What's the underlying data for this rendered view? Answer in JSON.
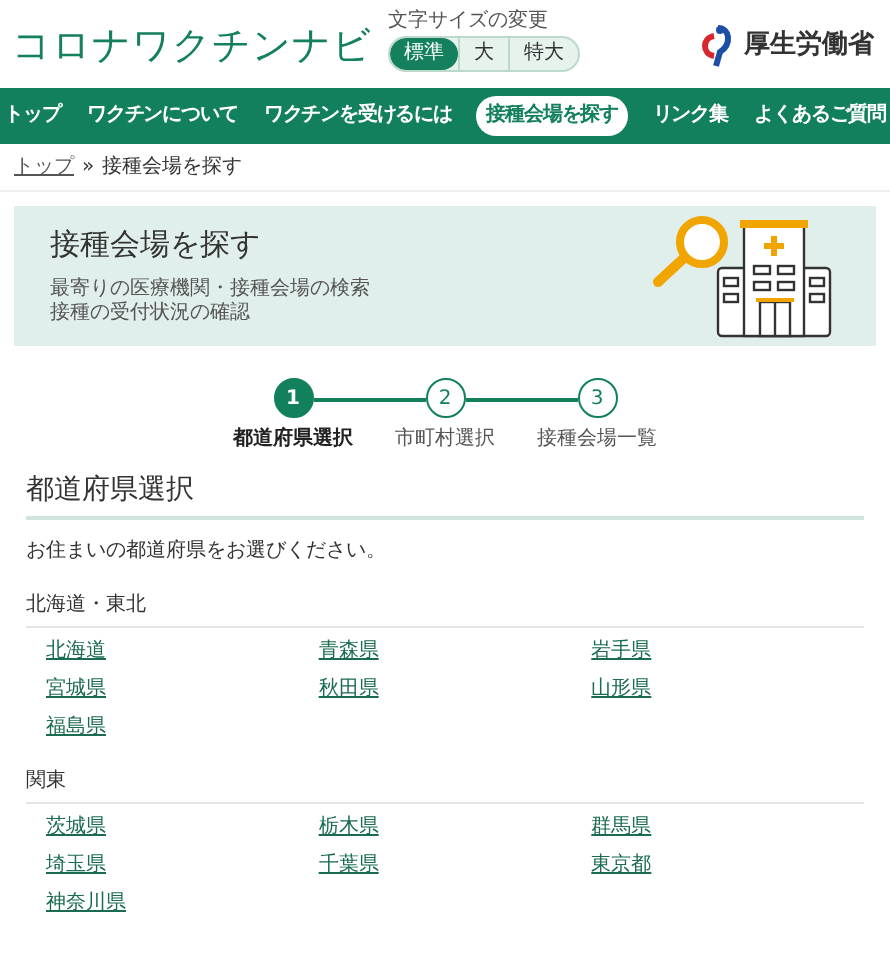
{
  "site_title": "コロナワクチンナビ",
  "font_size": {
    "label": "文字サイズの変更",
    "options": [
      {
        "label": "標準",
        "selected": true
      },
      {
        "label": "大",
        "selected": false
      },
      {
        "label": "特大",
        "selected": false
      }
    ]
  },
  "ministry": "厚生労働省",
  "nav": [
    {
      "label": "トップ",
      "selected": false
    },
    {
      "label": "ワクチンについて",
      "selected": false
    },
    {
      "label": "ワクチンを受けるには",
      "selected": false
    },
    {
      "label": "接種会場を探す",
      "selected": true
    },
    {
      "label": "リンク集",
      "selected": false
    },
    {
      "label": "よくあるご質問",
      "selected": false
    }
  ],
  "breadcrumb": {
    "link": "トップ",
    "separator": "»",
    "current": "接種会場を探す"
  },
  "hero": {
    "title": "接種会場を探す",
    "lines": [
      "最寄りの医療機関・接種会場の検索",
      "接種の受付状況の確認"
    ]
  },
  "steps": [
    {
      "number": "1",
      "label": "都道府県選択",
      "selected": true
    },
    {
      "number": "2",
      "label": "市町村選択",
      "selected": false
    },
    {
      "number": "3",
      "label": "接種会場一覧",
      "selected": false
    }
  ],
  "section_title": "都道府県選択",
  "instruction": "お住まいの都道府県をお選びください。",
  "regions": [
    {
      "name": "北海道・東北",
      "prefectures": [
        "北海道",
        "青森県",
        "岩手県",
        "宮城県",
        "秋田県",
        "山形県",
        "福島県"
      ]
    },
    {
      "name": "関東",
      "prefectures": [
        "茨城県",
        "栃木県",
        "群馬県",
        "埼玉県",
        "千葉県",
        "東京都",
        "神奈川県"
      ]
    }
  ]
}
